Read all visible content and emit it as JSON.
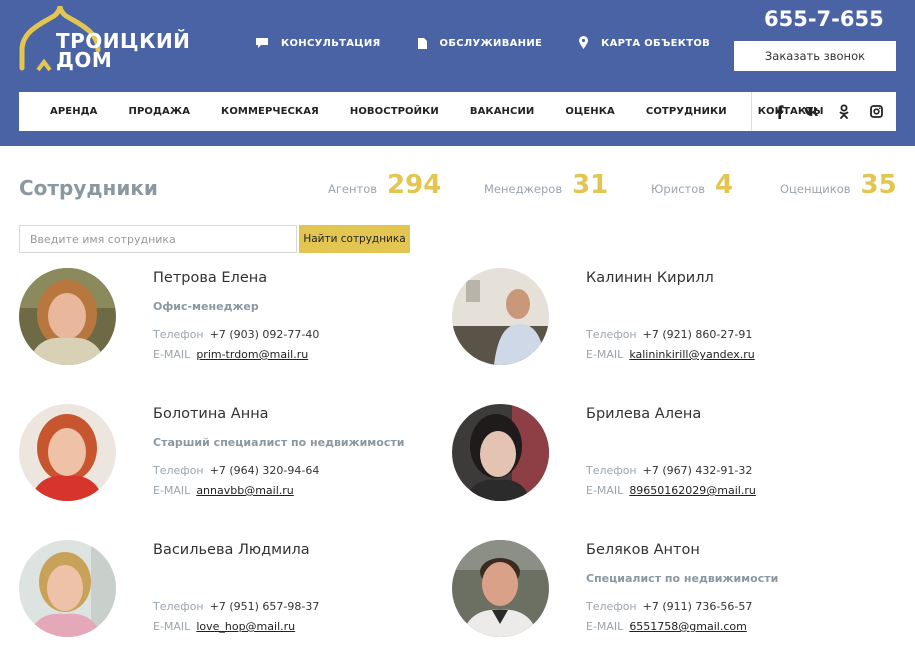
{
  "header": {
    "logo_line1": "ТРОИЦКИЙ",
    "logo_line2": "ДОМ",
    "phone": "655-7-655",
    "callback_label": "Заказать звонок",
    "topnav": [
      {
        "label": "КОНСУЛЬТАЦИЯ",
        "icon": "chat-icon"
      },
      {
        "label": "ОБСЛУЖИВАНИЕ",
        "icon": "document-icon"
      },
      {
        "label": "КАРТА ОБЪЕКТОВ",
        "icon": "map-pin-icon"
      }
    ],
    "mainnav": [
      "АРЕНДА",
      "ПРОДАЖА",
      "КОММЕРЧЕСКАЯ",
      "НОВОСТРОЙКИ",
      "ВАКАНСИИ",
      "ОЦЕНКА",
      "СОТРУДНИКИ",
      "КОНТАКТЫ"
    ],
    "social": [
      {
        "name": "facebook-icon",
        "glyph": "f"
      },
      {
        "name": "vk-icon",
        "glyph": "vk"
      },
      {
        "name": "odnoklassniki-icon",
        "glyph": "ok"
      },
      {
        "name": "instagram-icon",
        "glyph": "ig"
      }
    ]
  },
  "page": {
    "title": "Сотрудники",
    "stats": [
      {
        "label": "Агентов",
        "value": "294"
      },
      {
        "label": "Менеджеров",
        "value": "31"
      },
      {
        "label": "Юристов",
        "value": "4"
      },
      {
        "label": "Оценщиков",
        "value": "35"
      }
    ]
  },
  "search": {
    "placeholder": "Введите имя сотрудника",
    "value": "",
    "button_label": "Найти сотрудника"
  },
  "labels": {
    "phone": "Телефон",
    "email": "E-MAIL"
  },
  "employees": [
    {
      "name": "Петрова Елена",
      "role": "Офис-менеджер",
      "phone": "+7 (903) 092-77-40",
      "email": "prim-trdom@mail.ru"
    },
    {
      "name": "Калинин Кирилл",
      "role": "",
      "phone": "+7 (921) 860-27-91",
      "email": "kalininkirill@yandex.ru"
    },
    {
      "name": "Болотина Анна",
      "role": "Старший специалист по недвижимости",
      "phone": "+7 (964) 320-94-64",
      "email": "annavbb@mail.ru"
    },
    {
      "name": "Брилева Алена",
      "role": "",
      "phone": "+7 (967) 432-91-32",
      "email": "89650162029@mail.ru"
    },
    {
      "name": "Васильева Людмила",
      "role": "",
      "phone": "+7 (951) 657-98-37",
      "email": "love_hop@mail.ru"
    },
    {
      "name": "Беляков Антон",
      "role": "Специалист по недвижимости",
      "phone": "+7 (911) 736-56-57",
      "email": "6551758@gmail.com"
    }
  ],
  "colors": {
    "header_bg": "#4a63a4",
    "accent_yellow": "#e3c652",
    "muted_gray": "#8a98a2"
  }
}
